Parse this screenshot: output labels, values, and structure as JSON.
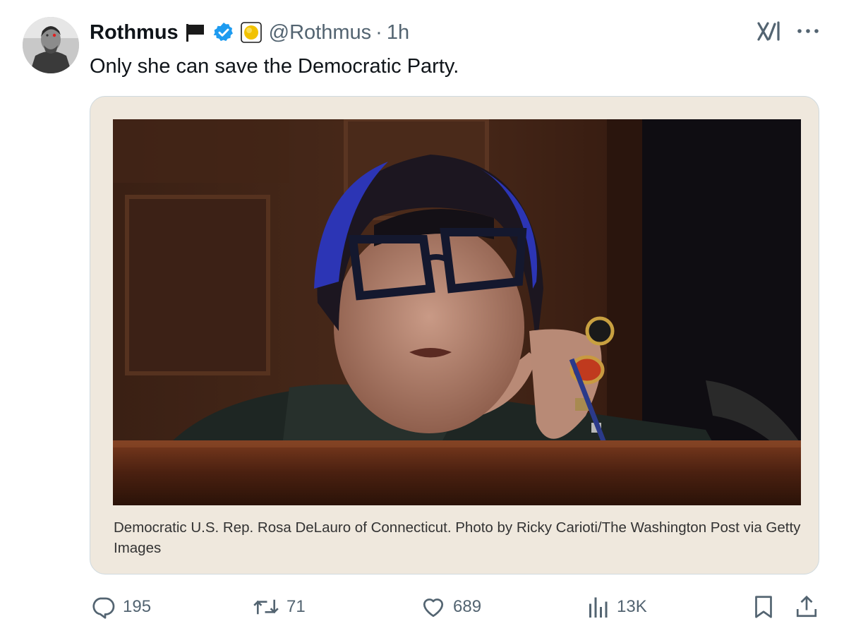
{
  "tweet": {
    "author_name": "Rothmus",
    "handle": "@Rothmus",
    "separator": "·",
    "time": "1h",
    "text": "Only she can save the Democratic Party.",
    "icons": {
      "flag": "black-flag-icon",
      "verified": "verified-badge-icon",
      "affiliate": "affiliate-badge-icon",
      "grok": "grok-icon",
      "more": "more-icon"
    },
    "colors": {
      "verified": "#1d9bf0",
      "secondary_text": "#536471",
      "card_bg": "#efe8dd"
    }
  },
  "card": {
    "caption": "Democratic U.S. Rep. Rosa DeLauro of Connecticut. Photo by Ricky Carioti/The Washington Post via Getty Images"
  },
  "actions": {
    "replies": "195",
    "reposts": "71",
    "likes": "689",
    "views": "13K"
  }
}
